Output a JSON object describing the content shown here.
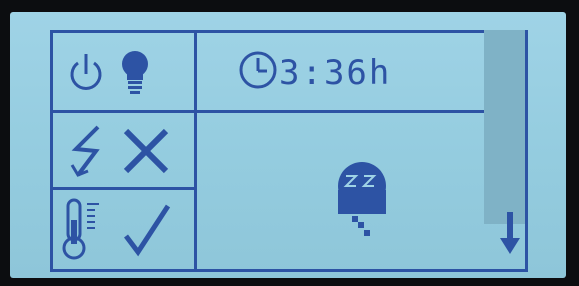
{
  "timer": {
    "value": "3:36h"
  },
  "icons": [
    "power-icon",
    "lightbulb-icon",
    "lightning-icon",
    "x-icon",
    "thermometer-icon",
    "checkmark-icon",
    "clock-icon",
    "sleeping-icon",
    "down-arrow-icon"
  ],
  "colors": {
    "screen": "#9fd3e6",
    "pixels": "#2d53a4",
    "scrollbar": "#7fb2c6"
  }
}
